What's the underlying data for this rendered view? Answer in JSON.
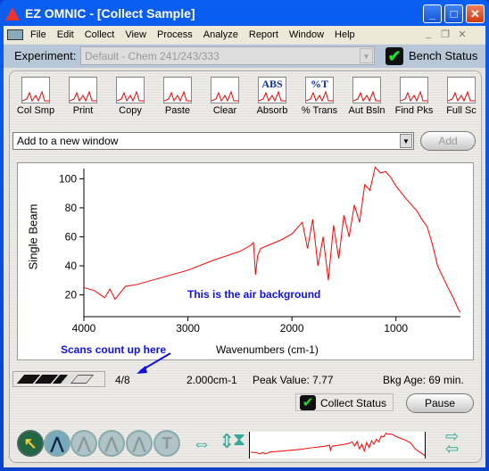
{
  "window": {
    "title": "EZ OMNIC - [Collect Sample]",
    "min": "_",
    "max": "□",
    "close": "✕"
  },
  "menu": [
    "File",
    "Edit",
    "Collect",
    "View",
    "Process",
    "Analyze",
    "Report",
    "Window",
    "Help"
  ],
  "experiment": {
    "label": "Experiment:",
    "value": "Default - Chem 241/243/333",
    "bench_status": "Bench Status"
  },
  "toolbar": [
    {
      "label": "Col Smp",
      "icon": "collect-sample-icon"
    },
    {
      "label": "Print",
      "icon": "printer-icon"
    },
    {
      "label": "Copy",
      "icon": "copy-icon"
    },
    {
      "label": "Paste",
      "icon": "paste-icon"
    },
    {
      "label": "Clear",
      "icon": "clear-icon"
    },
    {
      "label": "Absorb",
      "icon": "absorbance-icon",
      "glyph": "ABS"
    },
    {
      "label": "% Trans",
      "icon": "transmittance-icon",
      "glyph": "%T"
    },
    {
      "label": "Aut Bsln",
      "icon": "auto-baseline-icon"
    },
    {
      "label": "Find Pks",
      "icon": "find-peaks-icon"
    },
    {
      "label": "Full Sc",
      "icon": "full-scale-icon"
    }
  ],
  "window_select": {
    "value": "Add to a new window",
    "add": "Add"
  },
  "annotations": {
    "air": "This is the air background",
    "scans": "Scans count up here"
  },
  "status": {
    "scans": "4/8",
    "scans_done": 4,
    "scans_total": 8,
    "resolution": "2.000cm-1",
    "peak": "Peak Value: 7.77",
    "bkg_age": "Bkg Age: 69 min.",
    "collect_status": "Collect Status",
    "pause": "Pause"
  },
  "bottom_tools": {
    "text_tool": "T"
  },
  "colors": {
    "spectrum": "#ff0000",
    "annotation": "#1010e0",
    "title_bar": "#0a5ef0"
  },
  "chart_data": {
    "type": "line",
    "xlabel": "Wavenumbers (cm-1)",
    "ylabel": "Single Beam",
    "xlim": [
      4000,
      380
    ],
    "ylim": [
      5,
      107
    ],
    "xticks": [
      4000,
      3000,
      2000,
      1000
    ],
    "yticks": [
      100,
      80,
      60,
      40,
      20
    ],
    "x": [
      4000,
      3900,
      3800,
      3750,
      3700,
      3600,
      3500,
      3250,
      3000,
      2750,
      2500,
      2400,
      2370,
      2350,
      2330,
      2300,
      2100,
      2000,
      1900,
      1850,
      1800,
      1750,
      1700,
      1650,
      1600,
      1550,
      1500,
      1450,
      1400,
      1350,
      1300,
      1250,
      1200,
      1150,
      1100,
      1050,
      1000,
      900,
      800,
      750,
      700,
      650,
      600,
      500,
      450,
      400,
      380
    ],
    "y": [
      25,
      23,
      18,
      24,
      17,
      26,
      27,
      32,
      37,
      44,
      50,
      54,
      56,
      34,
      47,
      52,
      58,
      62,
      70,
      52,
      72,
      40,
      60,
      30,
      68,
      45,
      75,
      60,
      82,
      70,
      96,
      92,
      108,
      104,
      105,
      101,
      95,
      86,
      78,
      72,
      67,
      55,
      40,
      25,
      18,
      10,
      8
    ]
  }
}
